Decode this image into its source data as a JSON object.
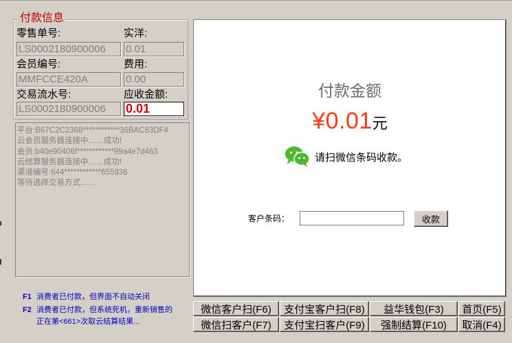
{
  "payment_info": {
    "group_title": "付款信息",
    "retail_no_label": "零售单号:",
    "retail_no": "LS0002180900006",
    "actual_label": "实洋:",
    "actual": "0.01",
    "member_no_label": "会员编号:",
    "member_no": "MMFCCE420A",
    "fee_label": "费用:",
    "fee": "0.00",
    "serial_label": "交易流水号:",
    "serial": "LS0002180900006",
    "receivable_label": "应收金额:",
    "receivable": "0.01"
  },
  "log_lines": [
    "平台:B67C2C2368************36BAC83DF4",
    "云会员服务器连接中... ...成功!",
    "会员:b40e90406f************99a4e7d463",
    "云结算服务器连接中... ...成功!",
    "渠道编号:644************655936",
    "等待选择交易方式... ..."
  ],
  "notes": {
    "f1_key": "F1",
    "f1_text": "消费者已付款，但界面不自动关闭",
    "f2_key": "F2",
    "f2_text": "消费者已付款，但系统死机，重新销售的",
    "f2_cont": "正在第<661>次取云结算结果..."
  },
  "main": {
    "amount_title": "付款金额",
    "amount_value": "¥0.01",
    "amount_unit": "元",
    "wechat_prompt": "请扫微信条码收款。",
    "wechat_icon": "wechat-icon",
    "customer_code_label": "客户条码：",
    "customer_code_value": "",
    "collect_button": "收款"
  },
  "buttons": {
    "wechat_scan_customer": "微信客户扫(F6)",
    "alipay_scan_customer": "支付宝客户扫(F8)",
    "yihua_wallet": "益华钱包(F3)",
    "home": "首页(F5)",
    "wechat_scan": "微信扫客户(F7)",
    "alipay_scan": "支付宝扫客户(F9)",
    "force_settle": "强制结算(F10)",
    "cancel": "取消(F4)"
  },
  "colors": {
    "accent_red": "#ff3b0f",
    "title_red": "#c00000",
    "note_blue": "#0000c0",
    "wechat_green": "#4eb734"
  }
}
